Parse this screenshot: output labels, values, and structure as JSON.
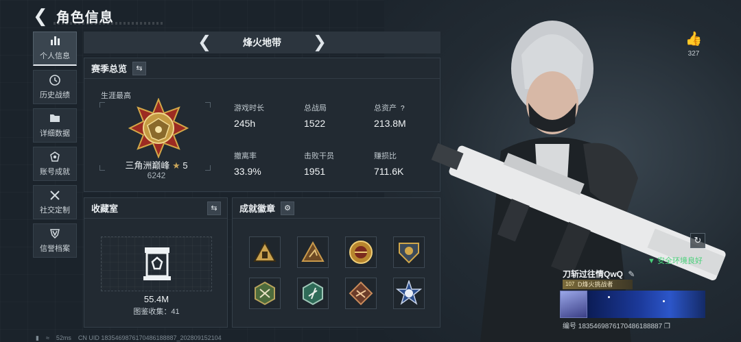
{
  "header": {
    "title": "角色信息"
  },
  "sidebar": {
    "items": [
      {
        "label": "个人信息",
        "icon": "bar-chart-icon",
        "active": true
      },
      {
        "label": "历史战绩",
        "icon": "clock-icon",
        "active": false
      },
      {
        "label": "详细数据",
        "icon": "folder-icon",
        "active": false
      },
      {
        "label": "账号成就",
        "icon": "badge-icon",
        "active": false
      },
      {
        "label": "社交定制",
        "icon": "tools-icon",
        "active": false
      },
      {
        "label": "信誉档案",
        "icon": "shield-icon",
        "active": false
      }
    ]
  },
  "mode_selector": {
    "current": "烽火地带"
  },
  "season": {
    "title": "赛季总览",
    "career_label": "生涯最高",
    "rank_name": "三角洲巅峰",
    "rank_stars": "5",
    "rank_score": "6242",
    "stats": [
      {
        "label": "游戏时长",
        "value": "245h"
      },
      {
        "label": "总战局",
        "value": "1522"
      },
      {
        "label": "总资产",
        "value": "213.8M",
        "help": "?"
      },
      {
        "label": "撤离率",
        "value": "33.9%"
      },
      {
        "label": "击败干员",
        "value": "1951"
      },
      {
        "label": "赚损比",
        "value": "711.6K"
      }
    ]
  },
  "collection": {
    "title": "收藏室",
    "value": "55.4M",
    "count_text": "图鉴收集：41"
  },
  "achievements": {
    "title": "成就徽章",
    "medals": [
      "warning-triangle-medal",
      "triangle-figure-medal",
      "gold-eagle-medal",
      "shield-crest-medal",
      "green-hex-medal",
      "emerald-hex-medal",
      "bronze-diamond-medal",
      "blue-star-medal"
    ]
  },
  "profile": {
    "likes": "327",
    "environment_status": "安全环境良好",
    "player_name": "刀斩过往情QwQ",
    "title_level": "107",
    "title_tag": "D烽火挑战者",
    "uid_line": "编号 1835469876170486188887"
  },
  "footer": {
    "ping": "52ms",
    "uid": "CN UID 1835469876170486188887_202809152104"
  }
}
